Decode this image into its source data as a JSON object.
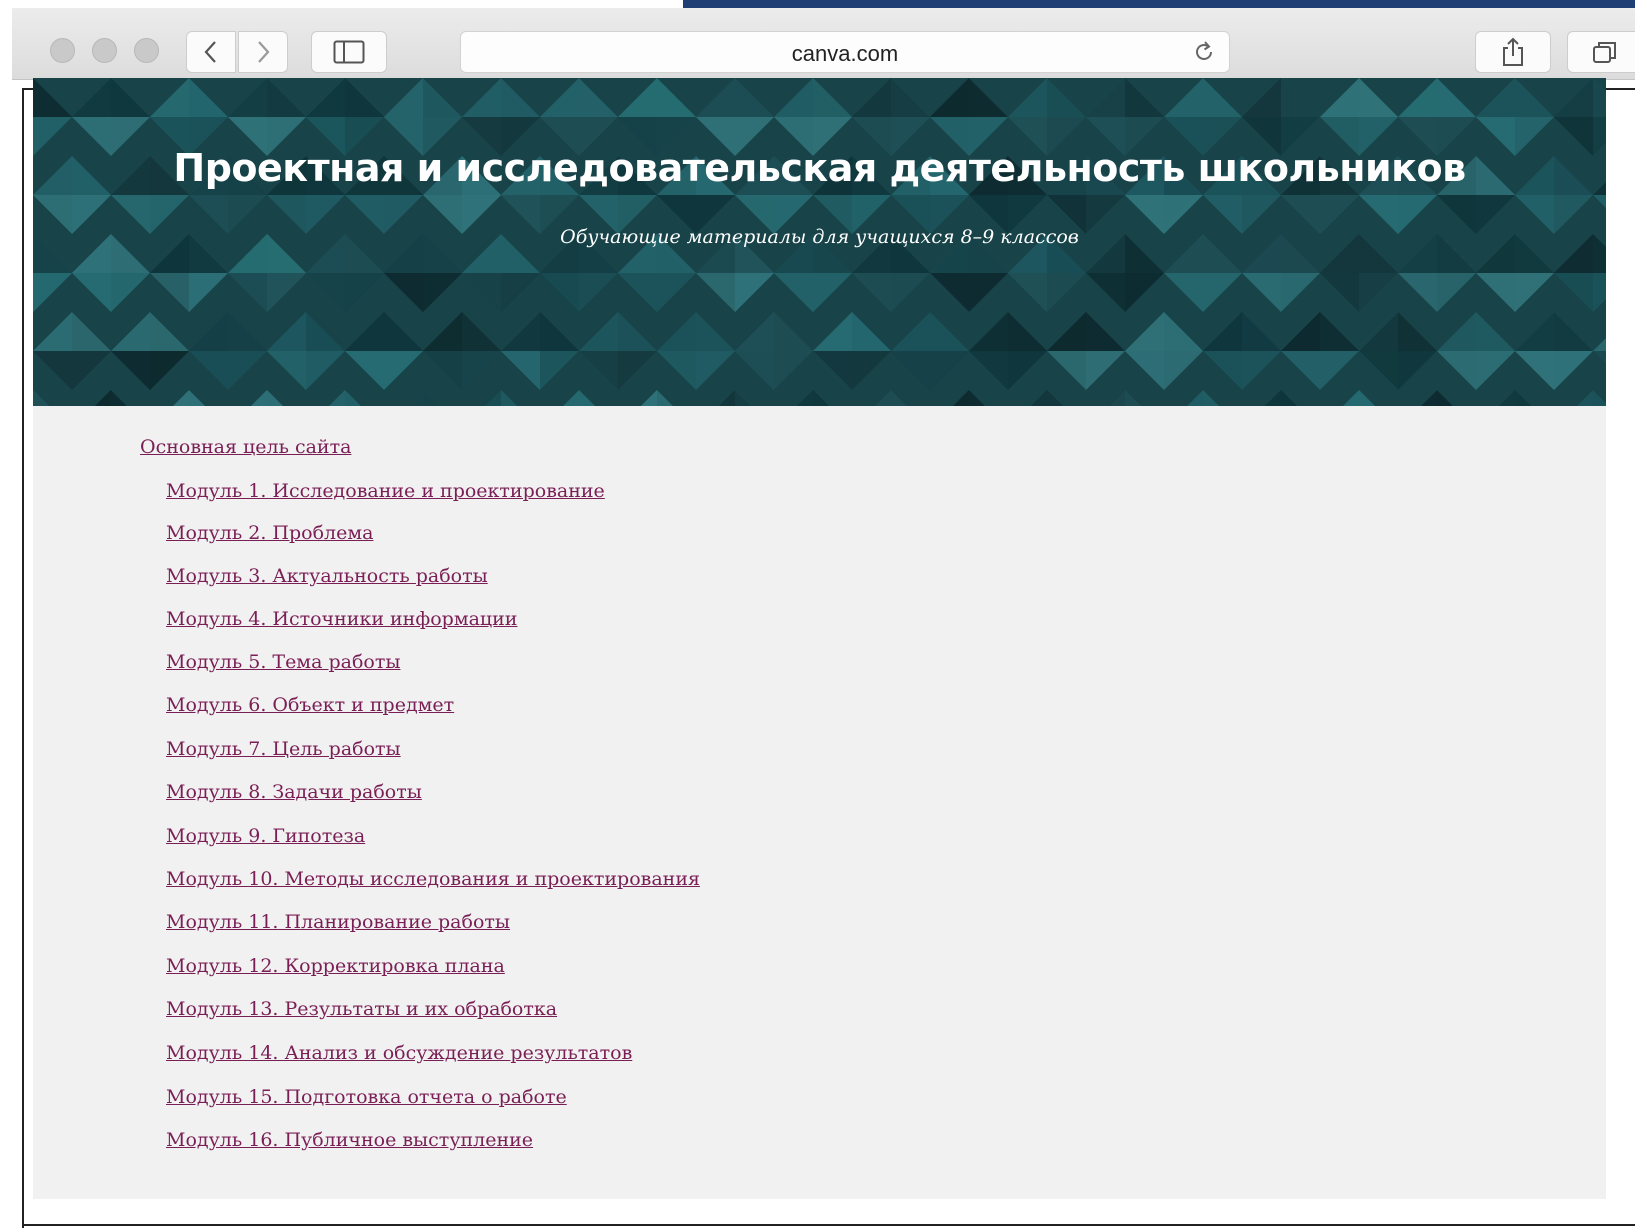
{
  "browser": {
    "url": "canva.com",
    "icons": {
      "back": "chevron-left-icon",
      "forward": "chevron-right-icon",
      "sidebar": "sidebar-icon",
      "reload": "reload-icon",
      "share": "share-icon",
      "tabs": "tabs-icon"
    }
  },
  "banner": {
    "title": "Проектная и исследовательская деятельность школьников",
    "subtitle": "Обучающие материалы для учащихся 8–9 классов"
  },
  "nav": {
    "main_link": "Основная цель сайта",
    "modules": [
      "Модуль 1. Исследование и проектирование",
      "Модуль 2. Проблема",
      "Модуль 3. Актуальность работы",
      "Модуль 4. Источники информации",
      "Модуль 5. Тема работы",
      "Модуль 6. Объект и предмет",
      "Модуль 7. Цель работы",
      "Модуль 8. Задачи работы",
      "Модуль 9. Гипотеза",
      "Модуль 10. Методы исследования и проектирования",
      "Модуль 11. Планирование работы",
      "Модуль 12. Корректировка плана",
      "Модуль 13. Результаты и их обработка",
      "Модуль 14. Анализ и обсуждение результатов",
      "Модуль 15. Подготовка отчета о работе",
      "Модуль 16. Публичное выступление"
    ]
  },
  "colors": {
    "link": "#7a1f55",
    "banner_base": "#1d4f57",
    "content_bg": "#f1f1f1"
  }
}
